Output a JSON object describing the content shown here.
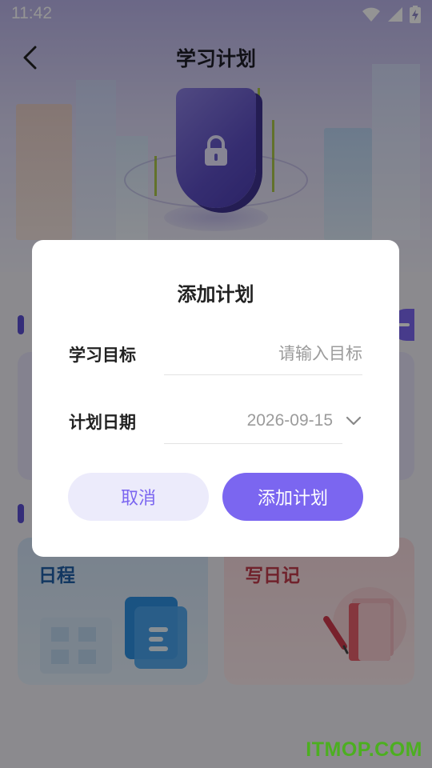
{
  "status_bar": {
    "time": "11:42"
  },
  "header": {
    "title": "学习计划"
  },
  "tiles": [
    {
      "title": "日程",
      "icon": "schedule-doc-icon"
    },
    {
      "title": "写日记",
      "icon": "diary-pen-icon"
    }
  ],
  "dialog": {
    "title": "添加计划",
    "goal": {
      "label": "学习目标",
      "value": "",
      "placeholder": "请输入目标"
    },
    "date": {
      "label": "计划日期",
      "value": "2026-09-15"
    },
    "cancel_label": "取消",
    "submit_label": "添加计划"
  },
  "watermark": "ITMOP.COM",
  "colors": {
    "accent": "#7b66f0",
    "accent_light": "#ecebfb",
    "watermark": "#4caf20"
  }
}
